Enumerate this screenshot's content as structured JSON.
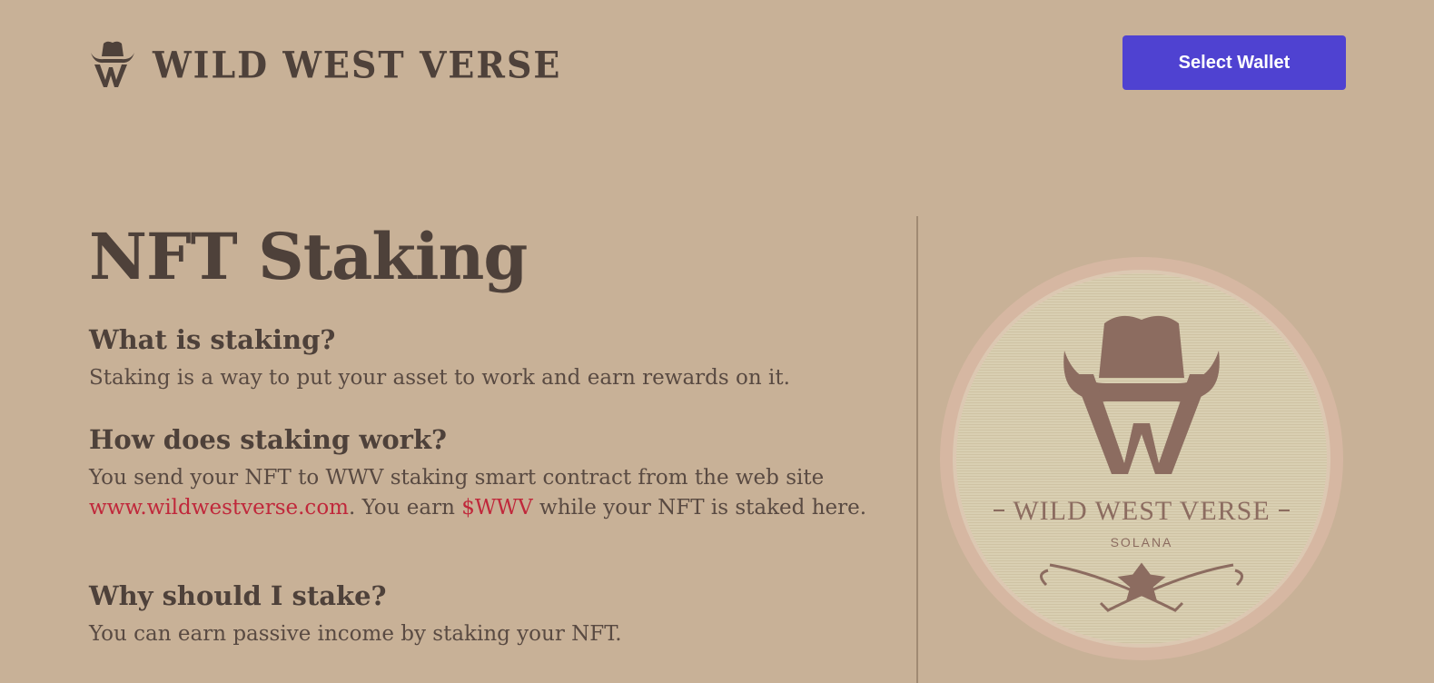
{
  "header": {
    "brand_name": "WILD WEST VERSE",
    "wallet_button_label": "Select Wallet"
  },
  "main": {
    "title": "NFT Staking",
    "sections": [
      {
        "heading": "What is staking?",
        "body": "Staking is a way to put your asset to work and earn rewards on it."
      },
      {
        "heading": "How does staking work?",
        "body_before_link": "You send your NFT to WWV staking smart contract from the web site ",
        "link_text": "www.wildwestverse.com",
        "body_middle": ". You earn ",
        "token_text": "$WWV",
        "body_after": " while your NFT is staked here."
      },
      {
        "heading": "Why should I stake?",
        "body": "You can earn passive income by staking your NFT."
      }
    ]
  },
  "emblem": {
    "brand_name": "WILD WEST VERSE",
    "subtitle": "SOLANA"
  },
  "colors": {
    "background": "#c8b197",
    "text": "#4e413a",
    "button": "#4f42d1",
    "accent": "#c0283b",
    "emblem_face": "#d7ccaf",
    "emblem_ring": "#d4b6a1"
  },
  "icons": {
    "logo": "cowboy-hat-w-logo",
    "emblem": "cowboy-hat-w-badge"
  }
}
